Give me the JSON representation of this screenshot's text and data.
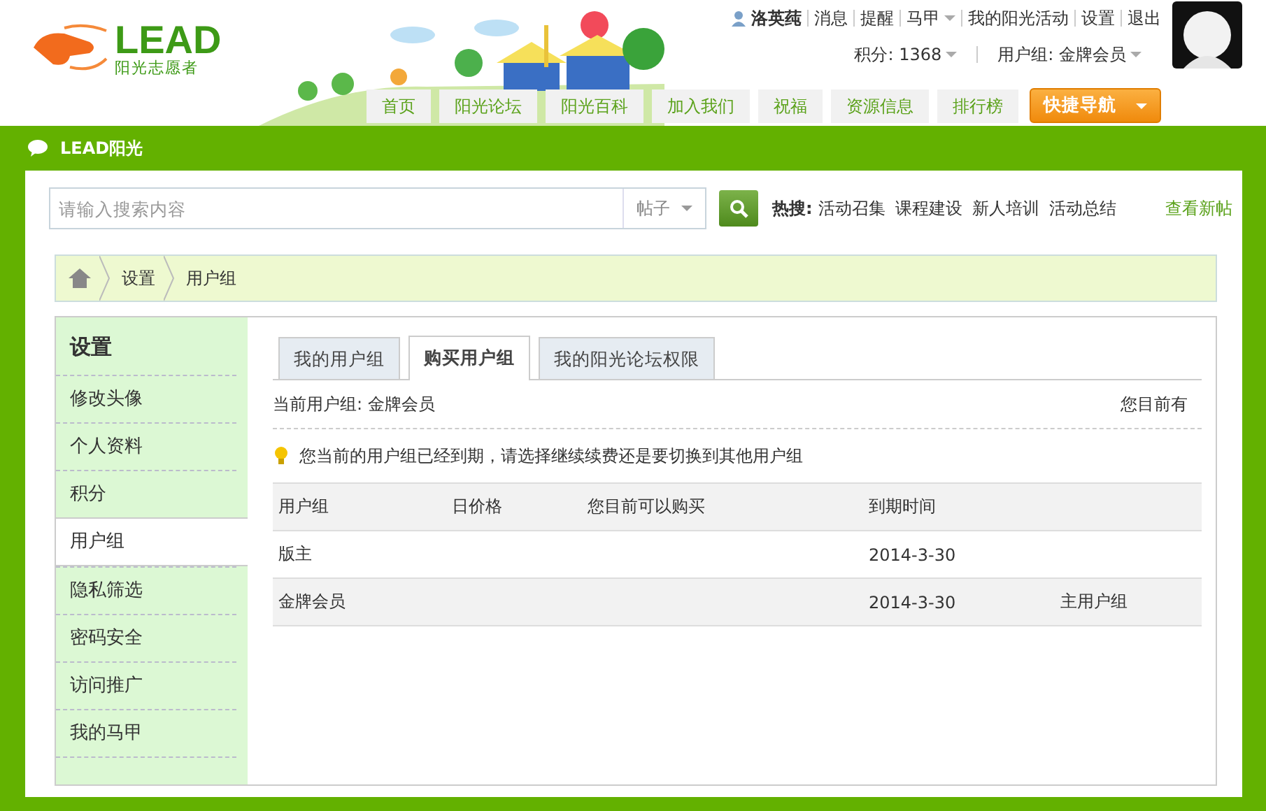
{
  "logo": {
    "title": "LEAD",
    "subtitle": "阳光志愿者"
  },
  "header": {
    "user_links": [
      {
        "label": "洛英莼",
        "kind": "user"
      },
      {
        "label": "消息",
        "kind": "link"
      },
      {
        "label": "提醒",
        "kind": "link"
      },
      {
        "label": "马甲",
        "kind": "dropdown"
      },
      {
        "label": "我的阳光活动",
        "kind": "link"
      },
      {
        "label": "设置",
        "kind": "link"
      },
      {
        "label": "退出",
        "kind": "link"
      }
    ],
    "points": "积分: 1368",
    "user_group": "用户组: 金牌会员"
  },
  "nav": [
    {
      "label": "首页"
    },
    {
      "label": "阳光论坛"
    },
    {
      "label": "阳光百科"
    },
    {
      "label": "加入我们"
    },
    {
      "label": "祝福"
    },
    {
      "label": "资源信息"
    },
    {
      "label": "排行榜"
    }
  ],
  "quick_nav": "快捷导航",
  "section_title": "LEAD阳光",
  "search": {
    "placeholder": "请输入搜索内容",
    "type": "帖子",
    "hot_label": "热搜:",
    "hot": [
      "活动召集",
      "课程建设",
      "新人培训",
      "活动总结"
    ],
    "new_posts": "查看新帖"
  },
  "breadcrumb": [
    "设置",
    "用户组"
  ],
  "sidebar": {
    "title": "设置",
    "items": [
      {
        "label": "修改头像",
        "selected": false
      },
      {
        "label": "个人资料",
        "selected": false
      },
      {
        "label": "积分",
        "selected": false
      },
      {
        "label": "用户组",
        "selected": true
      },
      {
        "label": "隐私筛选",
        "selected": false
      },
      {
        "label": "密码安全",
        "selected": false
      },
      {
        "label": "访问推广",
        "selected": false
      },
      {
        "label": "我的马甲",
        "selected": false
      }
    ]
  },
  "tabs": [
    {
      "label": "我的用户组",
      "selected": false
    },
    {
      "label": "购买用户组",
      "selected": true
    },
    {
      "label": "我的阳光论坛权限",
      "selected": false
    }
  ],
  "current_group": "当前用户组: 金牌会员",
  "current_right": "您目前有",
  "notice": "您当前的用户组已经到期，请选择继续续费还是要切换到其他用户组",
  "table": {
    "columns": [
      "用户组",
      "日价格",
      "您目前可以购买",
      "到期时间",
      ""
    ],
    "rows": [
      [
        "版主",
        "",
        "",
        "2014-3-30",
        ""
      ],
      [
        "金牌会员",
        "",
        "",
        "2014-3-30",
        "主用户组"
      ]
    ]
  }
}
